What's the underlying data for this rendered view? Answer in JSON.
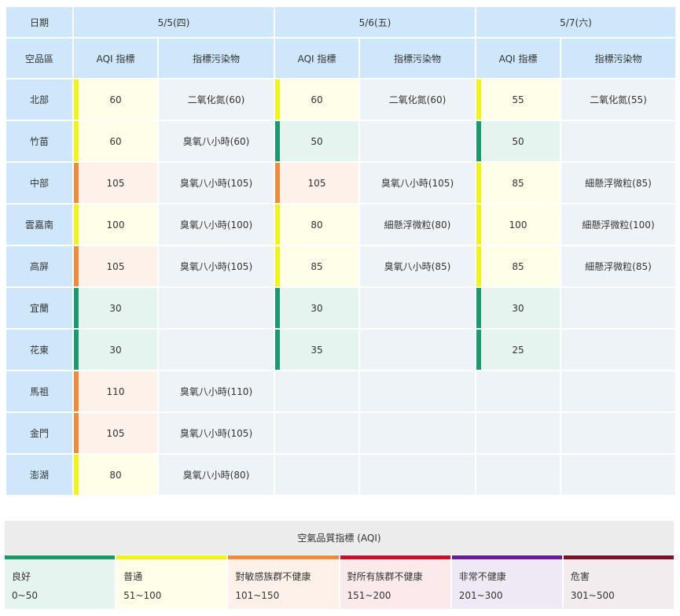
{
  "headers": {
    "date": "日期",
    "region": "空品區",
    "aqi": "AQI 指標",
    "pollutant": "指標污染物",
    "days": [
      "5/5(四)",
      "5/6(五)",
      "5/7(六)"
    ]
  },
  "rows": [
    {
      "region": "北部",
      "aqi": [
        "60",
        "60",
        "55"
      ],
      "pol": [
        "二氧化氮(60)",
        "二氧化氮(60)",
        "二氧化氮(55)"
      ]
    },
    {
      "region": "竹苗",
      "aqi": [
        "60",
        "50",
        "50"
      ],
      "pol": [
        "臭氧八小時(60)",
        "",
        ""
      ]
    },
    {
      "region": "中部",
      "aqi": [
        "105",
        "105",
        "85"
      ],
      "pol": [
        "臭氧八小時(105)",
        "臭氧八小時(105)",
        "細懸浮微粒(85)"
      ]
    },
    {
      "region": "雲嘉南",
      "aqi": [
        "100",
        "80",
        "100"
      ],
      "pol": [
        "臭氧八小時(100)",
        "細懸浮微粒(80)",
        "細懸浮微粒(100)"
      ]
    },
    {
      "region": "高屏",
      "aqi": [
        "105",
        "85",
        "85"
      ],
      "pol": [
        "臭氧八小時(105)",
        "臭氧八小時(85)",
        "細懸浮微粒(85)"
      ]
    },
    {
      "region": "宜蘭",
      "aqi": [
        "30",
        "30",
        "30"
      ],
      "pol": [
        "",
        "",
        ""
      ]
    },
    {
      "region": "花東",
      "aqi": [
        "30",
        "35",
        "25"
      ],
      "pol": [
        "",
        "",
        ""
      ]
    },
    {
      "region": "馬祖",
      "aqi": [
        "110",
        "",
        ""
      ],
      "pol": [
        "臭氧八小時(110)",
        "",
        ""
      ]
    },
    {
      "region": "金門",
      "aqi": [
        "105",
        "",
        ""
      ],
      "pol": [
        "臭氧八小時(105)",
        "",
        ""
      ]
    },
    {
      "region": "澎湖",
      "aqi": [
        "80",
        "",
        ""
      ],
      "pol": [
        "臭氧八小時(80)",
        "",
        ""
      ]
    }
  ],
  "legend": {
    "title": "空氣品質指標 (AQI)",
    "levels": [
      {
        "name": "良好",
        "range": "0~50",
        "color": "#1a9a6c",
        "bg": "#e6f4ef"
      },
      {
        "name": "普通",
        "range": "51~100",
        "color": "#f3f11a",
        "bg": "#fefee9"
      },
      {
        "name": "對敏感族群不健康",
        "range": "101~150",
        "color": "#f08a3c",
        "bg": "#fdf1ea"
      },
      {
        "name": "對所有族群不健康",
        "range": "151~200",
        "color": "#c8102e",
        "bg": "#fbe9ec"
      },
      {
        "name": "非常不健康",
        "range": "201~300",
        "color": "#6a1b9a",
        "bg": "#efe9f5"
      },
      {
        "name": "危害",
        "range": "301~500",
        "color": "#7b1228",
        "bg": "#f3ecee"
      }
    ]
  }
}
